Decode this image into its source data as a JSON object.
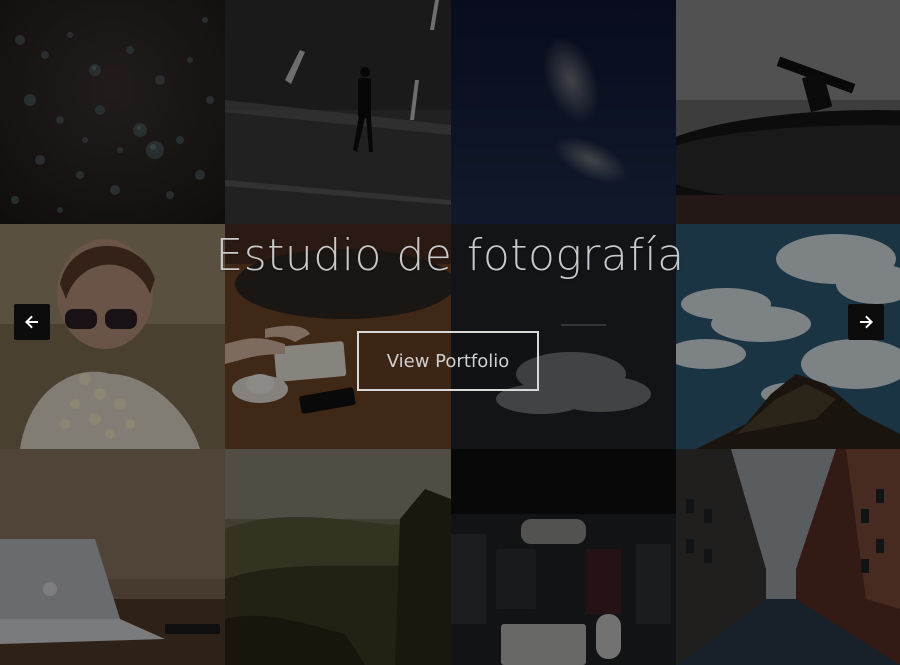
{
  "hero": {
    "title": "Estudio de fotografía",
    "cta_label": "View Portfolio"
  },
  "navigation": {
    "prev_icon": "arrow-left-icon",
    "next_icon": "arrow-right-icon"
  },
  "tiles": [
    {
      "subject": "water-drops-photo"
    },
    {
      "subject": "man-walking-road-photo"
    },
    {
      "subject": "night-sky-cloud-photo"
    },
    {
      "subject": "record-player-photo"
    },
    {
      "subject": "woman-sunglasses-flowers-photo"
    },
    {
      "subject": "desk-notebook-coffee-photo"
    },
    {
      "subject": "dark-clouds-photo"
    },
    {
      "subject": "sky-clouds-rock-photo"
    },
    {
      "subject": "laptop-desk-photo"
    },
    {
      "subject": "hills-landscape-photo"
    },
    {
      "subject": "workspace-keyboard-photo"
    },
    {
      "subject": "city-street-photo"
    }
  ],
  "colors": {
    "overlay": "#000000",
    "title_text": "#c9c9c9",
    "button_border": "#d8d8d8",
    "arrow_bg": "#0c0c0c"
  }
}
